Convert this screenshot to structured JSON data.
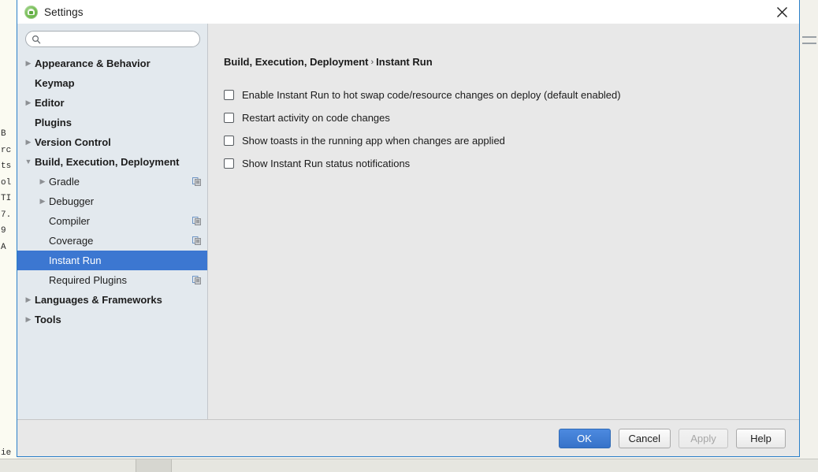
{
  "window": {
    "title": "Settings",
    "app_icon": "android-studio-icon",
    "close_icon": "close-icon"
  },
  "search": {
    "icon": "search-icon",
    "value": "",
    "placeholder": ""
  },
  "sidebar": {
    "items": [
      {
        "label": "Appearance & Behavior",
        "twisty": "▶",
        "level": 0,
        "bold": true,
        "selected": false,
        "copy": false
      },
      {
        "label": "Keymap",
        "twisty": "",
        "level": 0,
        "bold": true,
        "selected": false,
        "copy": false
      },
      {
        "label": "Editor",
        "twisty": "▶",
        "level": 0,
        "bold": true,
        "selected": false,
        "copy": false
      },
      {
        "label": "Plugins",
        "twisty": "",
        "level": 0,
        "bold": true,
        "selected": false,
        "copy": false
      },
      {
        "label": "Version Control",
        "twisty": "▶",
        "level": 0,
        "bold": true,
        "selected": false,
        "copy": false
      },
      {
        "label": "Build, Execution, Deployment",
        "twisty": "▼",
        "level": 0,
        "bold": true,
        "selected": false,
        "copy": false
      },
      {
        "label": "Gradle",
        "twisty": "▶",
        "level": 1,
        "bold": false,
        "selected": false,
        "copy": true
      },
      {
        "label": "Debugger",
        "twisty": "▶",
        "level": 1,
        "bold": false,
        "selected": false,
        "copy": false
      },
      {
        "label": "Compiler",
        "twisty": "",
        "level": 1,
        "bold": false,
        "selected": false,
        "copy": true
      },
      {
        "label": "Coverage",
        "twisty": "",
        "level": 1,
        "bold": false,
        "selected": false,
        "copy": true
      },
      {
        "label": "Instant Run",
        "twisty": "",
        "level": 1,
        "bold": false,
        "selected": true,
        "copy": false
      },
      {
        "label": "Required Plugins",
        "twisty": "",
        "level": 1,
        "bold": false,
        "selected": false,
        "copy": true
      },
      {
        "label": "Languages & Frameworks",
        "twisty": "▶",
        "level": 0,
        "bold": true,
        "selected": false,
        "copy": false
      },
      {
        "label": "Tools",
        "twisty": "▶",
        "level": 0,
        "bold": true,
        "selected": false,
        "copy": false
      }
    ]
  },
  "content": {
    "breadcrumb_parent": "Build, Execution, Deployment",
    "breadcrumb_separator": "›",
    "breadcrumb_current": "Instant Run",
    "options": [
      {
        "label": "Enable Instant Run to hot swap code/resource changes on deploy (default enabled)",
        "checked": false
      },
      {
        "label": "Restart activity on code changes",
        "checked": false
      },
      {
        "label": "Show toasts in the running app when changes are applied",
        "checked": false
      },
      {
        "label": "Show Instant Run status notifications",
        "checked": false
      }
    ]
  },
  "footer": {
    "buttons": [
      {
        "label": "OK",
        "style": "primary",
        "disabled": false
      },
      {
        "label": "Cancel",
        "style": "normal",
        "disabled": false
      },
      {
        "label": "Apply",
        "style": "disabled",
        "disabled": true
      },
      {
        "label": "Help",
        "style": "normal",
        "disabled": false
      }
    ]
  },
  "backdrop": {
    "code_fragments": [
      "B",
      "rc",
      "ts",
      "ol",
      "TI",
      "",
      "7.",
      "9",
      "A"
    ],
    "bottom_fragment": "ie"
  },
  "colors": {
    "selection_blue": "#3c77d1",
    "dialog_border": "#2a7fc9",
    "sidebar_bg": "#e3e9ee",
    "content_bg": "#e8e8e8",
    "primary_button": "#3772c9"
  }
}
